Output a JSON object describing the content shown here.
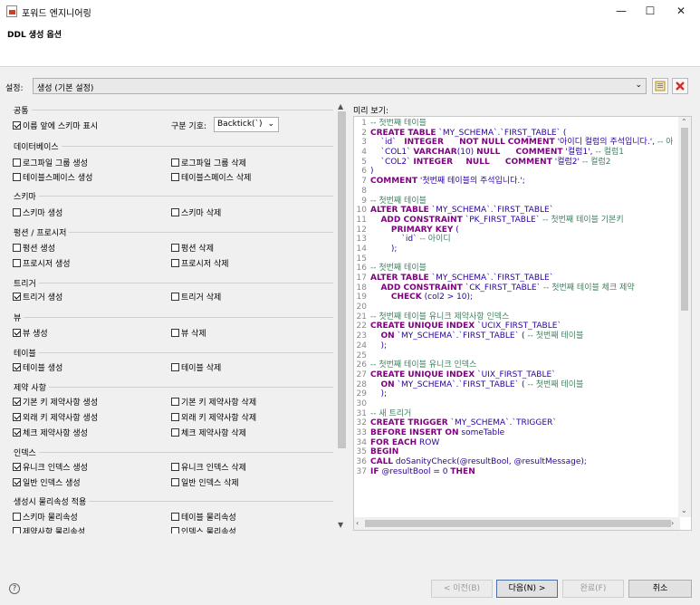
{
  "window": {
    "title": "포워드 엔지니어링",
    "minimize": "—",
    "maximize": "☐",
    "close": "✕"
  },
  "header": {
    "title": "DDL 생성 옵션"
  },
  "settings": {
    "label": "설정:",
    "value": "생성 (기본 설정)"
  },
  "options": {
    "common": {
      "title": "공통",
      "schema_prefix": "이름 앞에 스키마 표시",
      "delimiter_label": "구분 기호:",
      "delimiter_value": "Backtick(`)"
    },
    "database": {
      "title": "데이터베이스",
      "items": [
        "로그파일 그룹 생성",
        "로그파일 그룹 삭제",
        "테이블스페이스 생성",
        "테이블스페이스 삭제"
      ]
    },
    "schema": {
      "title": "스키마",
      "items": [
        "스키마 생성",
        "스키마 삭제"
      ]
    },
    "function": {
      "title": "펑션 / 프로시저",
      "items": [
        "펑션 생성",
        "펑션 삭제",
        "프로시저 생성",
        "프로시저 삭제"
      ]
    },
    "trigger": {
      "title": "트리거",
      "items": [
        "트리거 생성",
        "트리거 삭제"
      ]
    },
    "view": {
      "title": "뷰",
      "items": [
        "뷰 생성",
        "뷰 삭제"
      ]
    },
    "table": {
      "title": "테이블",
      "items": [
        "테이블 생성",
        "테이블 삭제"
      ]
    },
    "constraint": {
      "title": "제약 사항",
      "items": [
        "기본 키 제약사항 생성",
        "기본 키 제약사항 삭제",
        "외래 키 제약사항 생성",
        "외래 키 제약사항 삭제",
        "체크 제약사항 생성",
        "체크 제약사항 삭제"
      ]
    },
    "index": {
      "title": "인덱스",
      "items": [
        "유니크 인덱스 생성",
        "유니크 인덱스 삭제",
        "일반 인덱스 생성",
        "일반 인덱스 삭제"
      ]
    },
    "physical": {
      "title": "생성시 물리속성 적용",
      "items": [
        "스키마 물리속성",
        "테이블 물리속성",
        "제약사항 물리속성",
        "인덱스 물리속성"
      ]
    }
  },
  "preview": {
    "label": "미리 보기:",
    "lines": [
      "-- 첫번째 테이블",
      "CREATE TABLE `MY_SCHEMA`.`FIRST_TABLE` (",
      "    `id`   INTEGER      NOT NULL COMMENT '아이디 컬럼의 주석입니다.', -- 아이디",
      "    `COL1` VARCHAR(10) NULL      COMMENT '컬럼1', -- 컬럼1",
      "    `COL2` INTEGER     NULL      COMMENT '컬럼2' -- 컬럼2",
      ")",
      "COMMENT '첫번째 테이블의 주석입니다.';",
      "",
      "-- 첫번째 테이블",
      "ALTER TABLE `MY_SCHEMA`.`FIRST_TABLE`",
      "    ADD CONSTRAINT `PK_FIRST_TABLE` -- 첫번째 테이블 기본키",
      "        PRIMARY KEY (",
      "            `id` -- 아이디",
      "        );",
      "",
      "-- 첫번째 테이블",
      "ALTER TABLE `MY_SCHEMA`.`FIRST_TABLE`",
      "    ADD CONSTRAINT `CK_FIRST_TABLE` -- 첫번째 테이블 체크 제약",
      "        CHECK (col2 > 10);",
      "",
      "-- 첫번째 테이블 유니크 제약사항 인덱스",
      "CREATE UNIQUE INDEX `UCIX_FIRST_TABLE`",
      "    ON `MY_SCHEMA`.`FIRST_TABLE` ( -- 첫번째 테이블",
      "    );",
      "",
      "-- 첫번째 테이블 유니크 인덱스",
      "CREATE UNIQUE INDEX `UIX_FIRST_TABLE`",
      "    ON `MY_SCHEMA`.`FIRST_TABLE` ( -- 첫번째 테이블",
      "    );",
      "",
      "-- 새 트리거",
      "CREATE TRIGGER `MY_SCHEMA`.`TRIGGER`",
      "BEFORE INSERT ON someTable",
      "FOR EACH ROW",
      "BEGIN",
      "CALL doSanityCheck(@resultBool, @resultMessage);",
      "IF @resultBool = 0 THEN"
    ]
  },
  "footer": {
    "help": "?",
    "back": "< 이전(B)",
    "next": "다음(N) >",
    "finish": "완료(F)",
    "cancel": "취소"
  },
  "icons": {
    "settings_dropdown": "chevron-down-icon",
    "save": "save-icon",
    "delete": "delete-icon",
    "help": "help-icon"
  },
  "colors": {
    "keyword": "#7f007f",
    "comment": "#3f7f5f",
    "text": "#2a00a0",
    "delete_icon": "#d92b2b"
  }
}
